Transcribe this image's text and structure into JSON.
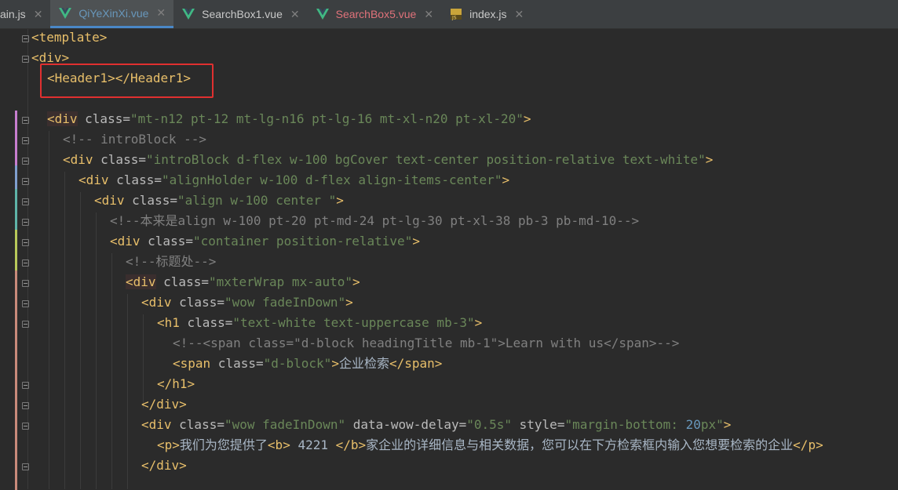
{
  "tabs": [
    {
      "label": "ain.js",
      "type": "js",
      "state": "normal"
    },
    {
      "label": "QiYeXinXi.vue",
      "type": "vue",
      "state": "active"
    },
    {
      "label": "SearchBox1.vue",
      "type": "vue",
      "state": "normal"
    },
    {
      "label": "SearchBox5.vue",
      "type": "vue",
      "state": "modified"
    },
    {
      "label": "index.js",
      "type": "js-file",
      "state": "normal"
    }
  ],
  "close_glyph": "✕",
  "colors": {
    "tag": "#e8bf6a",
    "attr": "#bababa",
    "string": "#6a8759",
    "comment": "#808080",
    "number": "#6897bb",
    "highlight": "#e03030",
    "vue_green": "#41b883"
  },
  "lines": [
    {
      "t1": "<template>"
    },
    {
      "t1": "<div>"
    },
    {
      "t1": "<Header1></Header1>"
    },
    {
      "t1": ""
    },
    {
      "t1": "<div",
      "a1": " class=",
      "v1": "\"mt-n12 pt-12 mt-lg-n16 pt-lg-16 mt-xl-n20 pt-xl-20\"",
      "t2": ">"
    },
    {
      "c1": "<!-- introBlock -->"
    },
    {
      "t1": "<div",
      "a1": " class=",
      "v1": "\"introBlock d-flex w-100 bgCover text-center position-relative text-white\"",
      "t2": ">"
    },
    {
      "t1": "<div",
      "a1": " class=",
      "v1": "\"alignHolder w-100 d-flex align-items-center\"",
      "t2": ">"
    },
    {
      "t1": "<div",
      "a1": " class=",
      "v1": "\"align w-100 center \"",
      "t2": ">"
    },
    {
      "c1": "<!--本来是align w-100 pt-20 pt-md-24 pt-lg-30 pt-xl-38 pb-3 pb-md-10-->"
    },
    {
      "t1": "<div",
      "a1": " class=",
      "v1": "\"container position-relative\"",
      "t2": ">"
    },
    {
      "c1": "<!--标题处-->"
    },
    {
      "t1": "<div",
      "a1": " class=",
      "v1": "\"mxterWrap mx-auto\"",
      "t2": ">"
    },
    {
      "t1": "<div",
      "a1": " class=",
      "v1": "\"wow fadeInDown\"",
      "t2": ">"
    },
    {
      "t1": "<h1",
      "a1": " class=",
      "v1": "\"text-white text-uppercase mb-3\"",
      "t2": ">"
    },
    {
      "c1": "<!--<span class=\"d-block headingTitle mb-1\">Learn with us</span>-->"
    },
    {
      "t1": "<span",
      "a1": " class=",
      "v1": "\"d-block\"",
      "t2": ">",
      "x1": "企业检索",
      "t3": "</span>"
    },
    {
      "t1": "</h1>"
    },
    {
      "t1": "</div>"
    },
    {
      "t1": "<div",
      "a1": " class=",
      "v1": "\"wow fadeInDown\"",
      "a2": " data-wow-delay=",
      "v2": "\"0.5s\"",
      "a3": " style=",
      "v3": "\"margin-bottom: ",
      "n1": "20",
      "v4": "px\"",
      "t2": ">"
    },
    {
      "t1": "<p>",
      "x1": "我们为您提供了",
      "t2": "<b>",
      "x2": " 4221 ",
      "t3": "</b>",
      "x3": "家企业的详细信息与相关数据，您可以在下方检索框内输入您想要检索的企业",
      "t4": "</p>"
    },
    {
      "t1": "</div>"
    }
  ]
}
